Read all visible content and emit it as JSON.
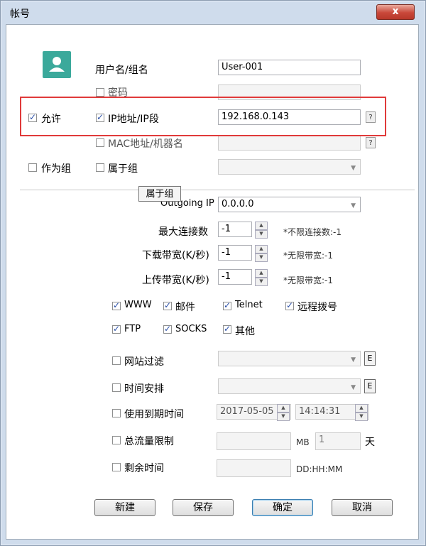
{
  "window": {
    "title": "帐号",
    "close_label": "x"
  },
  "account": {
    "username_label": "用户名/组名",
    "username_value": "User-001",
    "password_label": "密码",
    "allow_label": "允许",
    "ip_label": "IP地址/IP段",
    "ip_value": "192.168.0.143",
    "mac_label": "MAC地址/机器名",
    "as_group_label": "作为组",
    "belongs_group_label": "属于组",
    "help_label": "?"
  },
  "tooltip": {
    "text": "属于组"
  },
  "outgoing": {
    "label": "Outgoing IP",
    "value": "0.0.0.0"
  },
  "limits": {
    "max_conn_label": "最大连接数",
    "max_conn_value": "-1",
    "max_conn_hint": "*不限连接数:-1",
    "down_label": "下载带宽(K/秒)",
    "down_value": "-1",
    "down_hint": "*无限带宽:-1",
    "up_label": "上传带宽(K/秒)",
    "up_value": "-1",
    "up_hint": "*无限带宽:-1"
  },
  "services": {
    "www": "WWW",
    "mail": "邮件",
    "telnet": "Telnet",
    "dialup": "远程拨号",
    "ftp": "FTP",
    "socks": "SOCKS",
    "other": "其他"
  },
  "options": {
    "site_filter": "网站过滤",
    "schedule": "时间安排",
    "expire": "使用到期时间",
    "expire_date": "2017-05-05",
    "expire_time": "14:14:31",
    "traffic_limit": "总流量限制",
    "mb_unit": "MB",
    "days_value": "1",
    "days_unit": "天",
    "remaining": "剩余时间",
    "remaining_unit": "DD:HH:MM",
    "edit_label": "E"
  },
  "buttons": {
    "new": "新建",
    "save": "保存",
    "ok": "确定",
    "cancel": "取消"
  },
  "colors": {
    "highlight_box": "#e03a3a",
    "avatar": "#3ba99b",
    "check": "#2a4fa8"
  }
}
